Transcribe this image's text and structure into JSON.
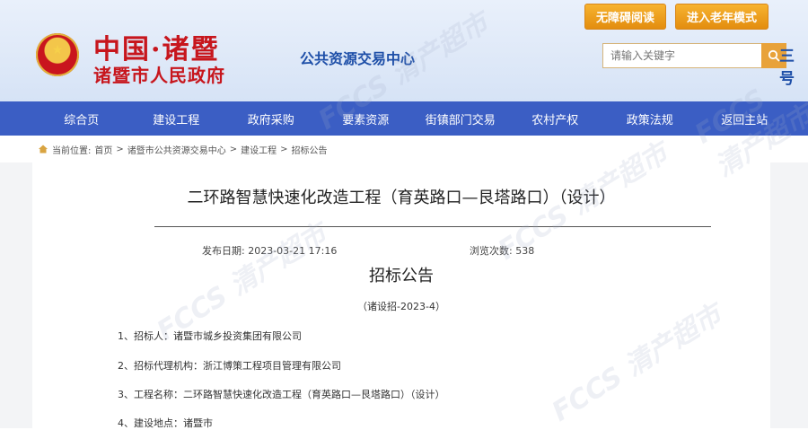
{
  "header": {
    "site_title": "中国·诸暨",
    "site_subtitle": "诸暨市人民政府",
    "center_name": "公共资源交易中心",
    "accessible_btn": "无障碍阅读",
    "elderly_btn": "进入老年模式",
    "search_placeholder": "请输入关键字",
    "lang_text": "三号"
  },
  "nav": [
    "综合页",
    "建设工程",
    "政府采购",
    "要素资源",
    "街镇部门交易",
    "农村产权",
    "政策法规",
    "返回主站"
  ],
  "breadcrumb": {
    "label": "当前位置:",
    "items": [
      "首页",
      "诸暨市公共资源交易中心",
      "建设工程",
      "招标公告"
    ],
    "sep": ">"
  },
  "article": {
    "title": "二环路智慧快速化改造工程（育英路口—艮塔路口）（设计）",
    "publish_label": "发布日期:",
    "publish_date": "2023-03-21 17:16",
    "views_label": "浏览次数:",
    "views": "538",
    "notice_title": "招标公告",
    "notice_no": "（诸设招-2023-4）",
    "items": [
      "1、招标人：诸暨市城乡投资集团有限公司",
      "2、招标代理机构：浙江博策工程项目管理有限公司",
      "3、工程名称：二环路智慧快速化改造工程（育英路口—艮塔路口）（设计）",
      "4、建设地点：诸暨市"
    ]
  },
  "watermark": "FCCS 清产超市",
  "colors": {
    "nav_bg": "#3b5ec4",
    "brand_red": "#c7161d",
    "btn_orange": "#e8a23a"
  }
}
